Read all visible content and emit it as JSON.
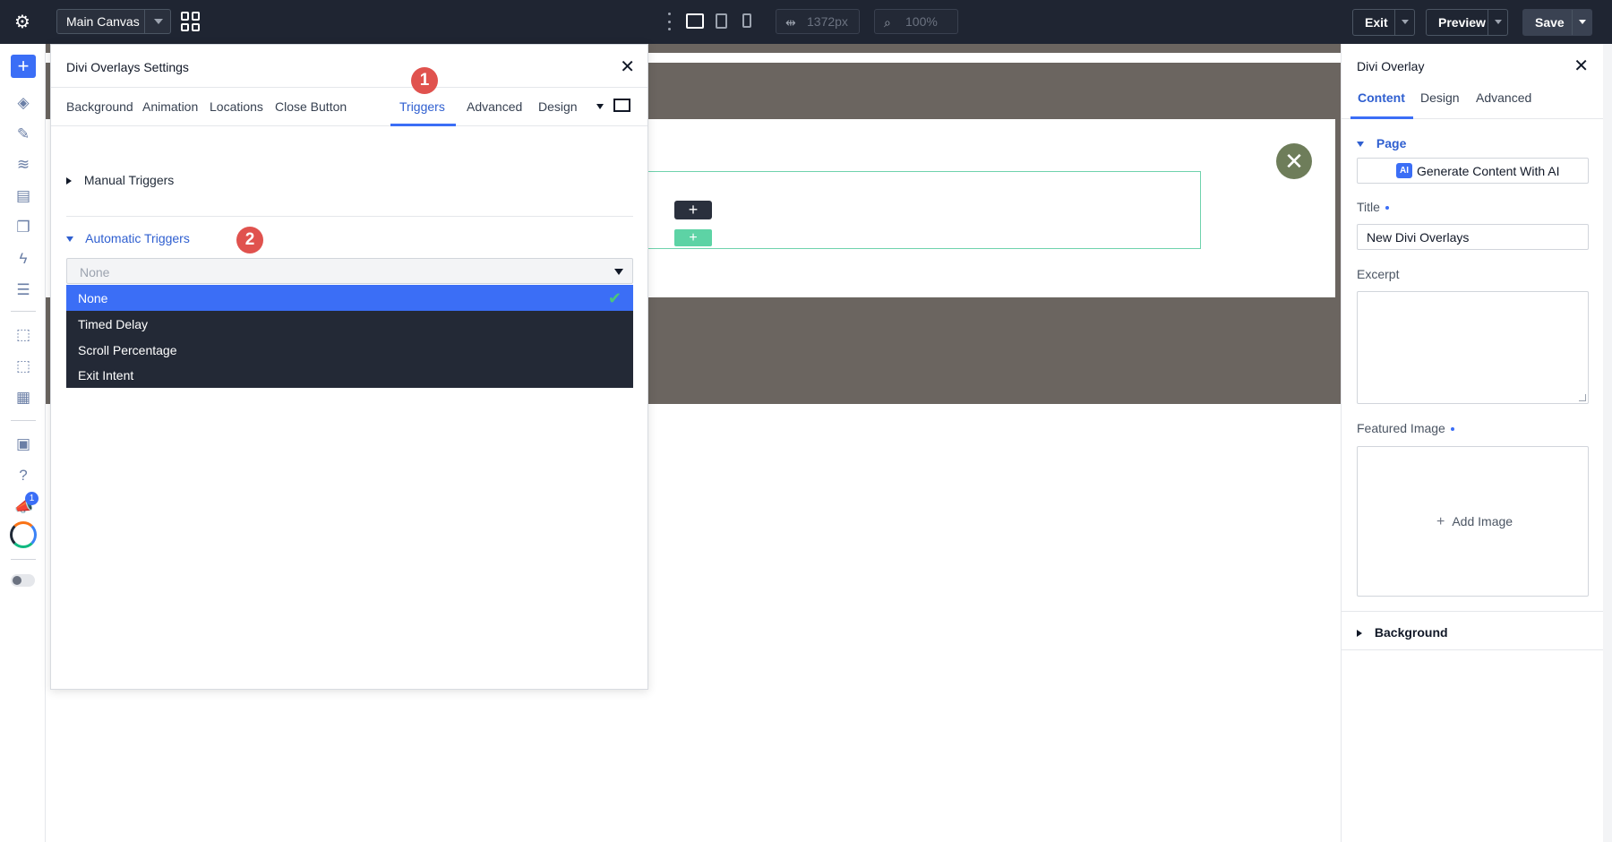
{
  "topbar": {
    "canvas_select": "Main Canvas",
    "width_readout": "1372px",
    "zoom_readout": "100%",
    "exit_label": "Exit",
    "preview_label": "Preview",
    "save_label": "Save"
  },
  "leftrail": {
    "notification_count": "1"
  },
  "modal": {
    "title": "Divi Overlays Settings",
    "tabs": [
      {
        "label": "Background"
      },
      {
        "label": "Animation"
      },
      {
        "label": "Locations"
      },
      {
        "label": "Close Button"
      },
      {
        "label": "Triggers"
      },
      {
        "label": "Advanced"
      },
      {
        "label": "Design"
      }
    ],
    "active_tab": "Triggers",
    "step1": "1",
    "step2": "2",
    "manual_triggers": "Manual Triggers",
    "automatic_triggers": "Automatic Triggers",
    "select_value": "None",
    "options": [
      {
        "label": "None"
      },
      {
        "label": "Timed Delay"
      },
      {
        "label": "Scroll Percentage"
      },
      {
        "label": "Exit Intent"
      }
    ]
  },
  "rpanel": {
    "title": "Divi Overlay",
    "tabs": [
      {
        "label": "Content"
      },
      {
        "label": "Design"
      },
      {
        "label": "Advanced"
      }
    ],
    "section_page": "Page",
    "ai_button": "Generate Content With AI",
    "ai_icon_text": "AI",
    "title_label": "Title",
    "title_value": "New Divi Overlays",
    "excerpt_label": "Excerpt",
    "featured_image_label": "Featured Image",
    "add_image": "Add Image",
    "background_section": "Background"
  },
  "colors": {
    "topbar": "#1f2532",
    "accent": "#3b6ef6",
    "step_badge": "#e0524e",
    "overlay_band": "#6b6560",
    "close_circle": "#6e7d5a",
    "section_outline": "#6fd3ad"
  }
}
